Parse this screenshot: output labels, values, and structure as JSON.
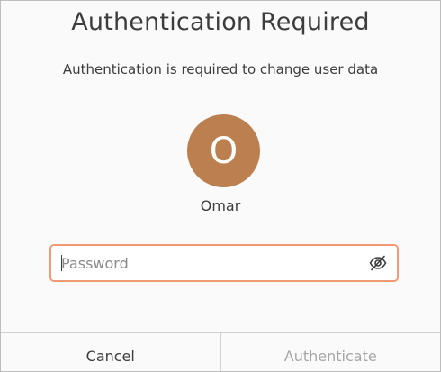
{
  "dialog": {
    "title": "Authentication Required",
    "message": "Authentication is required to change user data"
  },
  "user": {
    "avatar_letter": "O",
    "avatar_color": "#bc7f4f",
    "name": "Omar"
  },
  "password_field": {
    "value": "",
    "placeholder": "Password",
    "toggle_icon": "eye-slash-icon",
    "focus_border_color": "#f19a74"
  },
  "buttons": {
    "cancel_label": "Cancel",
    "authenticate_label": "Authenticate",
    "authenticate_enabled": false
  }
}
